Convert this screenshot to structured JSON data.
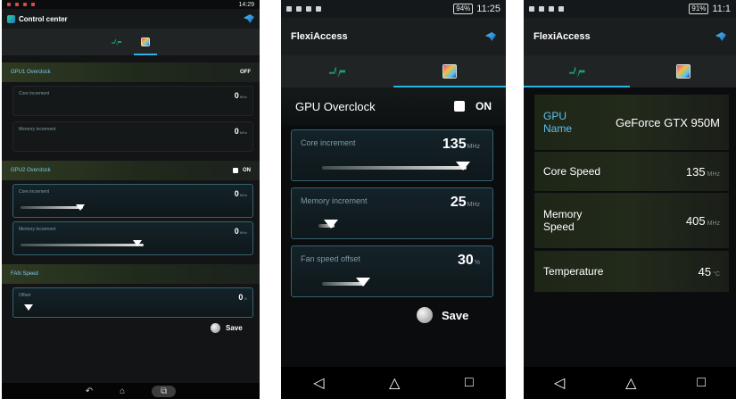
{
  "screen1": {
    "status": {
      "time": "14:29"
    },
    "title": "Control center",
    "tabs": [
      {
        "icon": "pulse-icon"
      },
      {
        "icon": "gpu-icon",
        "active": true
      }
    ],
    "gpu1": {
      "label": "GPU1 Overclock",
      "toggle": "OFF"
    },
    "gpu1_core": {
      "label": "Core increment",
      "value": "0",
      "unit": "MHz"
    },
    "gpu1_mem": {
      "label": "Memory increment",
      "value": "0",
      "unit": "MHz"
    },
    "gpu2": {
      "label": "GPU2 Overclock",
      "toggle": "ON",
      "checked": true
    },
    "gpu2_core": {
      "label": "Core increment",
      "value": "0",
      "unit": "MHz"
    },
    "gpu2_mem": {
      "label": "Memory increment",
      "value": "0",
      "unit": "MHz"
    },
    "fan": {
      "label": "FAN Speed"
    },
    "fan_offset": {
      "label": "Offset",
      "value": "0",
      "unit": "%"
    },
    "save": "Save"
  },
  "screen2": {
    "status": {
      "time": "11:25",
      "battery": "94%"
    },
    "title": "FlexiAccess",
    "tabs": [
      {
        "icon": "pulse-icon"
      },
      {
        "icon": "gpu-icon",
        "active": true
      }
    ],
    "gpu": {
      "label": "GPU Overclock",
      "toggle": "ON",
      "checked": true
    },
    "core": {
      "label": "Core increment",
      "value": "135",
      "unit": "MHz"
    },
    "memory": {
      "label": "Memory increment",
      "value": "25",
      "unit": "MHz"
    },
    "fan": {
      "label": "Fan speed offset",
      "value": "30",
      "unit": "%"
    },
    "save": "Save"
  },
  "screen3": {
    "status": {
      "time": "11:1",
      "battery": "91%"
    },
    "title": "FlexiAccess",
    "tabs": [
      {
        "icon": "pulse-icon",
        "active": true
      },
      {
        "icon": "gpu-icon"
      }
    ],
    "rows": [
      {
        "label": "GPU Name",
        "value": "GeForce GTX 950M",
        "unit": ""
      },
      {
        "label": "Core Speed",
        "value": "135",
        "unit": "MHz"
      },
      {
        "label": "Memory Speed",
        "value": "405",
        "unit": "MHz"
      },
      {
        "label": "Temperature",
        "value": "45",
        "unit": "°C"
      }
    ]
  },
  "nav": {
    "back": "◁",
    "home": "△",
    "recent": "□"
  },
  "colors": {
    "accent": "#2bb3e8",
    "card_border": "#34636f",
    "section_bg": "#2f3a22"
  }
}
